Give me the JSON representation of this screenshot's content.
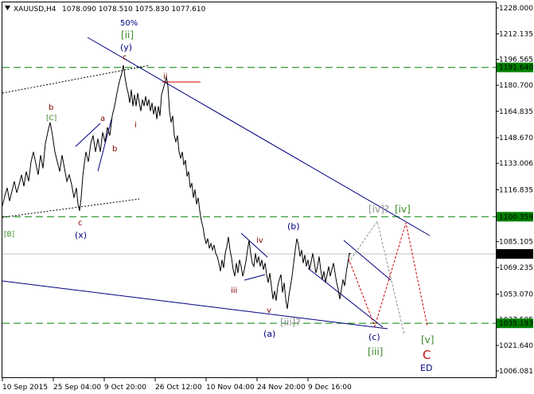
{
  "header": {
    "symbol": "XAUUSD,H4",
    "ohlc": "1078.090 1078.510 1075.830 1077.610"
  },
  "colors": {
    "price": "#000000",
    "grid_dash": "#008000",
    "trend_navy": "#000080",
    "wave_red": "#800000",
    "wave_green": "#3a8a28",
    "wave_gray": "#909090",
    "projection_red": "#d00000",
    "tag_bg": "#008000",
    "current_tag_bg": "#000000"
  },
  "chart_data": {
    "type": "line",
    "y_ticks": [
      "1228.000",
      "1212.135",
      "1196.565",
      "1180.700",
      "1164.835",
      "1148.670",
      "1133.006",
      "1116.835",
      "1100.359",
      "1085.105",
      "1069.235",
      "1053.070",
      "1037.505",
      "1021.640",
      "1006.081"
    ],
    "ylim": [
      1006.081,
      1228.0
    ],
    "x_ticks": [
      "10 Sep 2015",
      "25 Sep 04:00",
      "9 Oct 20:00",
      "26 Oct 12:00",
      "10 Nov 04:00",
      "24 Nov 20:00",
      "9 Dec 16:00"
    ],
    "levels": [
      {
        "value": 1191.64,
        "label": "1191.640"
      },
      {
        "value": 1100.359,
        "label": "1100.359"
      },
      {
        "value": 1035.193,
        "label": "1035.193"
      }
    ],
    "current_price": {
      "value": 1077.61,
      "label": "1077.610"
    },
    "price_path": [
      [
        0,
        1107
      ],
      [
        3,
        1113
      ],
      [
        6,
        1118
      ],
      [
        9,
        1110
      ],
      [
        12,
        1116
      ],
      [
        15,
        1122
      ],
      [
        18,
        1115
      ],
      [
        21,
        1120
      ],
      [
        24,
        1126
      ],
      [
        27,
        1119
      ],
      [
        30,
        1128
      ],
      [
        33,
        1122
      ],
      [
        36,
        1134
      ],
      [
        39,
        1140
      ],
      [
        42,
        1133
      ],
      [
        45,
        1126
      ],
      [
        48,
        1138
      ],
      [
        51,
        1130
      ],
      [
        54,
        1145
      ],
      [
        57,
        1152
      ],
      [
        60,
        1158
      ],
      [
        63,
        1150
      ],
      [
        66,
        1140
      ],
      [
        69,
        1134
      ],
      [
        72,
        1128
      ],
      [
        75,
        1138
      ],
      [
        78,
        1130
      ],
      [
        81,
        1122
      ],
      [
        84,
        1126
      ],
      [
        87,
        1120
      ],
      [
        90,
        1112
      ],
      [
        93,
        1118
      ],
      [
        95,
        1108
      ],
      [
        97,
        1104
      ],
      [
        99,
        1112
      ],
      [
        101,
        1125
      ],
      [
        103,
        1133
      ],
      [
        105,
        1140
      ],
      [
        108,
        1134
      ],
      [
        111,
        1145
      ],
      [
        114,
        1150
      ],
      [
        117,
        1140
      ],
      [
        120,
        1148
      ],
      [
        123,
        1140
      ],
      [
        126,
        1152
      ],
      [
        129,
        1146
      ],
      [
        132,
        1155
      ],
      [
        135,
        1150
      ],
      [
        138,
        1162
      ],
      [
        141,
        1168
      ],
      [
        144,
        1176
      ],
      [
        147,
        1183
      ],
      [
        150,
        1188
      ],
      [
        152,
        1193
      ],
      [
        154,
        1186
      ],
      [
        156,
        1180
      ],
      [
        158,
        1176
      ],
      [
        160,
        1170
      ],
      [
        162,
        1178
      ],
      [
        164,
        1168
      ],
      [
        166,
        1175
      ],
      [
        168,
        1168
      ],
      [
        170,
        1176
      ],
      [
        172,
        1170
      ],
      [
        174,
        1165
      ],
      [
        176,
        1172
      ],
      [
        178,
        1168
      ],
      [
        180,
        1174
      ],
      [
        182,
        1168
      ],
      [
        184,
        1172
      ],
      [
        186,
        1165
      ],
      [
        188,
        1170
      ],
      [
        190,
        1163
      ],
      [
        192,
        1168
      ],
      [
        194,
        1160
      ],
      [
        196,
        1168
      ],
      [
        198,
        1162
      ],
      [
        200,
        1175
      ],
      [
        203,
        1180
      ],
      [
        206,
        1186
      ],
      [
        208,
        1180
      ],
      [
        210,
        1165
      ],
      [
        212,
        1158
      ],
      [
        214,
        1162
      ],
      [
        216,
        1150
      ],
      [
        218,
        1146
      ],
      [
        220,
        1150
      ],
      [
        222,
        1140
      ],
      [
        224,
        1136
      ],
      [
        226,
        1140
      ],
      [
        228,
        1132
      ],
      [
        230,
        1135
      ],
      [
        232,
        1125
      ],
      [
        234,
        1128
      ],
      [
        236,
        1118
      ],
      [
        238,
        1121
      ],
      [
        240,
        1112
      ],
      [
        242,
        1117
      ],
      [
        244,
        1108
      ],
      [
        246,
        1112
      ],
      [
        248,
        1104
      ],
      [
        250,
        1098
      ],
      [
        252,
        1094
      ],
      [
        254,
        1088
      ],
      [
        256,
        1084
      ],
      [
        258,
        1087
      ],
      [
        260,
        1081
      ],
      [
        262,
        1084
      ],
      [
        264,
        1080
      ],
      [
        266,
        1083
      ],
      [
        268,
        1078
      ],
      [
        270,
        1076
      ],
      [
        272,
        1072
      ],
      [
        274,
        1067
      ],
      [
        276,
        1074
      ],
      [
        278,
        1069
      ],
      [
        280,
        1078
      ],
      [
        282,
        1082
      ],
      [
        284,
        1088
      ],
      [
        286,
        1080
      ],
      [
        288,
        1075
      ],
      [
        290,
        1068
      ],
      [
        292,
        1064
      ],
      [
        294,
        1072
      ],
      [
        296,
        1066
      ],
      [
        298,
        1074
      ],
      [
        300,
        1070
      ],
      [
        302,
        1064
      ],
      [
        304,
        1068
      ],
      [
        306,
        1073
      ],
      [
        308,
        1080
      ],
      [
        310,
        1086
      ],
      [
        312,
        1078
      ],
      [
        314,
        1072
      ],
      [
        316,
        1070
      ],
      [
        318,
        1078
      ],
      [
        320,
        1072
      ],
      [
        322,
        1076
      ],
      [
        324,
        1070
      ],
      [
        326,
        1074
      ],
      [
        328,
        1068
      ],
      [
        330,
        1072
      ],
      [
        332,
        1065
      ],
      [
        334,
        1060
      ],
      [
        336,
        1066
      ],
      [
        338,
        1058
      ],
      [
        340,
        1050
      ],
      [
        342,
        1055
      ],
      [
        344,
        1049
      ],
      [
        346,
        1058
      ],
      [
        348,
        1062
      ],
      [
        350,
        1065
      ],
      [
        352,
        1054
      ],
      [
        354,
        1060
      ],
      [
        356,
        1050
      ],
      [
        358,
        1044
      ],
      [
        360,
        1052
      ],
      [
        362,
        1058
      ],
      [
        364,
        1064
      ],
      [
        366,
        1072
      ],
      [
        368,
        1080
      ],
      [
        370,
        1087
      ],
      [
        372,
        1083
      ],
      [
        374,
        1076
      ],
      [
        376,
        1080
      ],
      [
        378,
        1072
      ],
      [
        380,
        1077
      ],
      [
        382,
        1070
      ],
      [
        384,
        1074
      ],
      [
        386,
        1068
      ],
      [
        388,
        1073
      ],
      [
        390,
        1078
      ],
      [
        392,
        1072
      ],
      [
        394,
        1066
      ],
      [
        396,
        1070
      ],
      [
        398,
        1076
      ],
      [
        400,
        1068
      ],
      [
        402,
        1062
      ],
      [
        404,
        1067
      ],
      [
        406,
        1060
      ],
      [
        408,
        1065
      ],
      [
        410,
        1070
      ],
      [
        412,
        1064
      ],
      [
        414,
        1068
      ],
      [
        416,
        1072
      ],
      [
        418,
        1066
      ],
      [
        420,
        1060
      ],
      [
        422,
        1056
      ],
      [
        424,
        1050
      ],
      [
        426,
        1056
      ],
      [
        428,
        1062
      ],
      [
        430,
        1058
      ],
      [
        432,
        1066
      ],
      [
        434,
        1072
      ],
      [
        436,
        1078
      ],
      [
        438,
        1077.6
      ]
    ]
  },
  "annotations": {
    "percent": "50%",
    "w_ii_big": "[ii]",
    "w_y": "(y)",
    "w_c_top": "c",
    "w_ii_red": "ii",
    "w_a": "a",
    "w_b_small": "b",
    "w_i": "i",
    "w_b_left": "b",
    "w_C_left": "[C]",
    "w_c_left": "c",
    "w_x": "(x)",
    "w_B": "[B]",
    "w_iv": "iv",
    "w_iii": "iii",
    "w_v": "v",
    "w_b_paren": "(b)",
    "w_a_paren": "(a)",
    "w_iii_gray": "[iii]?",
    "w_iv_q": "[iv]?",
    "w_iv_green": "[iv]",
    "w_c_paren": "(c)",
    "w_iii_green": "[iii]",
    "w_v_green": "[v]",
    "w_C_red": "C",
    "w_ED": "ED"
  }
}
